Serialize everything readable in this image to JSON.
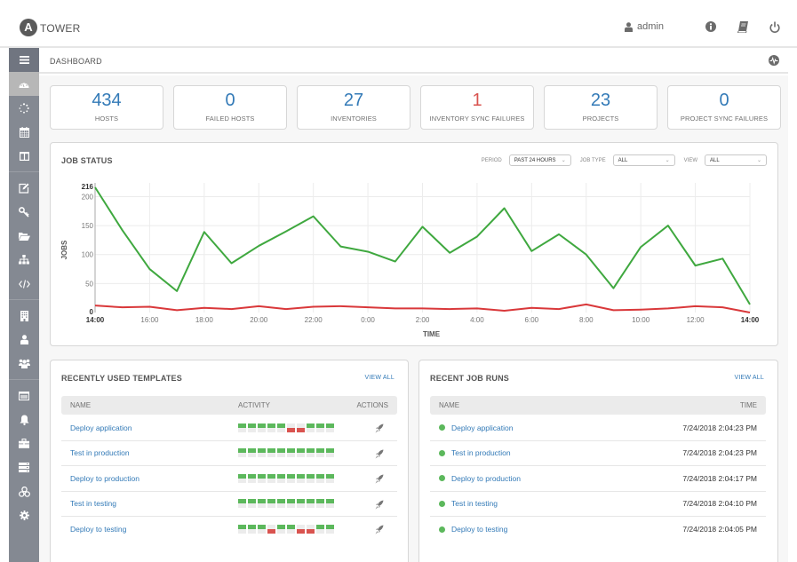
{
  "app": {
    "logo_letter": "A",
    "brand": "TOWER",
    "user": "admin",
    "icons": [
      "user-icon",
      "info-icon",
      "docs-book-icon",
      "power-logout-icon"
    ]
  },
  "breadcrumb": {
    "title": "DASHBOARD",
    "activity_icon": "activity-stream-icon"
  },
  "sidebar": {
    "items": [
      {
        "name": "menu",
        "icon": "hamburger-menu-icon"
      },
      {
        "name": "dashboard",
        "icon": "dashboard-gauge-icon",
        "active": true
      },
      {
        "name": "jobs",
        "icon": "jobs-spinner-icon"
      },
      {
        "name": "schedules",
        "icon": "calendar-icon"
      },
      {
        "name": "portal",
        "icon": "portal-columns-icon"
      },
      {
        "name": "templates",
        "icon": "edit-template-icon"
      },
      {
        "name": "credentials",
        "icon": "key-icon"
      },
      {
        "name": "projects",
        "icon": "folder-open-icon"
      },
      {
        "name": "inventories",
        "icon": "sitemap-icon"
      },
      {
        "name": "inventory-scripts",
        "icon": "code-icon"
      },
      {
        "name": "organizations",
        "icon": "building-icon"
      },
      {
        "name": "users",
        "icon": "user-icon"
      },
      {
        "name": "teams",
        "icon": "users-group-icon"
      },
      {
        "name": "credential-types",
        "icon": "window-card-icon"
      },
      {
        "name": "notifications",
        "icon": "bell-icon"
      },
      {
        "name": "management-jobs",
        "icon": "briefcase-icon"
      },
      {
        "name": "instance-groups",
        "icon": "server-stack-icon"
      },
      {
        "name": "applications",
        "icon": "cubes-icon"
      },
      {
        "name": "settings",
        "icon": "gear-icon"
      }
    ]
  },
  "counts": [
    {
      "value": "434",
      "label": "HOSTS",
      "status": "normal"
    },
    {
      "value": "0",
      "label": "FAILED HOSTS",
      "status": "normal"
    },
    {
      "value": "27",
      "label": "INVENTORIES",
      "status": "normal"
    },
    {
      "value": "1",
      "label": "INVENTORY SYNC FAILURES",
      "status": "fail"
    },
    {
      "value": "23",
      "label": "PROJECTS",
      "status": "normal"
    },
    {
      "value": "0",
      "label": "PROJECT SYNC FAILURES",
      "status": "normal"
    }
  ],
  "job_status": {
    "title": "JOB STATUS",
    "filters": {
      "period_label": "PERIOD",
      "period_value": "PAST 24 HOURS",
      "job_type_label": "JOB TYPE",
      "job_type_value": "ALL",
      "view_label": "VIEW",
      "view_value": "ALL"
    }
  },
  "chart_data": {
    "type": "line",
    "title": "JOB STATUS",
    "xlabel": "TIME",
    "ylabel": "JOBS",
    "x": [
      "14:00",
      "15:00",
      "16:00",
      "17:00",
      "18:00",
      "19:00",
      "20:00",
      "21:00",
      "22:00",
      "23:00",
      "0:00",
      "1:00",
      "2:00",
      "3:00",
      "4:00",
      "5:00",
      "6:00",
      "7:00",
      "8:00",
      "9:00",
      "10:00",
      "11:00",
      "12:00",
      "13:00",
      "14:00"
    ],
    "x_tick_labels": [
      "14:00",
      "16:00",
      "18:00",
      "20:00",
      "22:00",
      "0:00",
      "2:00",
      "4:00",
      "6:00",
      "8:00",
      "10:00",
      "12:00",
      "14:00"
    ],
    "y_tick_labels": [
      "0",
      "50",
      "100",
      "150",
      "200",
      "216"
    ],
    "ylim": [
      0,
      216
    ],
    "grid": true,
    "series": [
      {
        "name": "successful",
        "color": "#3fa83f",
        "values": [
          216,
          142,
          75,
          37,
          139,
          85,
          115,
          140,
          166,
          114,
          105,
          88,
          148,
          103,
          131,
          180,
          106,
          135,
          100,
          42,
          113,
          150,
          81,
          93,
          14
        ]
      },
      {
        "name": "failed",
        "color": "#d9383a",
        "values": [
          12,
          9,
          10,
          4,
          8,
          6,
          11,
          6,
          10,
          11,
          9,
          7,
          7,
          6,
          7,
          3,
          8,
          6,
          14,
          4,
          5,
          7,
          11,
          9,
          0
        ]
      }
    ]
  },
  "templates": {
    "title": "RECENTLY USED TEMPLATES",
    "view_all": "VIEW ALL",
    "columns": [
      "NAME",
      "ACTIVITY",
      "ACTIONS"
    ],
    "rows": [
      {
        "name": "Deploy application",
        "activity": [
          "ok",
          "ok",
          "ok",
          "ok",
          "ok",
          "fail",
          "fail",
          "ok",
          "ok",
          "ok"
        ],
        "action_icon": "rocket-launch-icon"
      },
      {
        "name": "Test in production",
        "activity": [
          "ok",
          "ok",
          "ok",
          "ok",
          "ok",
          "ok",
          "ok",
          "ok",
          "ok",
          "ok"
        ],
        "action_icon": "rocket-launch-icon"
      },
      {
        "name": "Deploy to production",
        "activity": [
          "ok",
          "ok",
          "ok",
          "ok",
          "ok",
          "ok",
          "ok",
          "ok",
          "ok",
          "ok"
        ],
        "action_icon": "rocket-launch-icon"
      },
      {
        "name": "Test in testing",
        "activity": [
          "ok",
          "ok",
          "ok",
          "ok",
          "ok",
          "ok",
          "ok",
          "ok",
          "ok",
          "ok"
        ],
        "action_icon": "rocket-launch-icon"
      },
      {
        "name": "Deploy to testing",
        "activity": [
          "ok",
          "ok",
          "ok",
          "fail",
          "ok",
          "ok",
          "fail",
          "fail",
          "ok",
          "ok"
        ],
        "action_icon": "rocket-launch-icon"
      }
    ]
  },
  "job_runs": {
    "title": "RECENT JOB RUNS",
    "view_all": "VIEW ALL",
    "columns": [
      "NAME",
      "TIME"
    ],
    "rows": [
      {
        "name": "Deploy application",
        "time": "7/24/2018 2:04:23 PM",
        "status": "successful"
      },
      {
        "name": "Test in production",
        "time": "7/24/2018 2:04:23 PM",
        "status": "successful"
      },
      {
        "name": "Deploy to production",
        "time": "7/24/2018 2:04:17 PM",
        "status": "successful"
      },
      {
        "name": "Test in testing",
        "time": "7/24/2018 2:04:10 PM",
        "status": "successful"
      },
      {
        "name": "Deploy to testing",
        "time": "7/24/2018 2:04:05 PM",
        "status": "successful"
      }
    ]
  },
  "colors": {
    "accent": "#337ab7",
    "fail": "#d9534f",
    "success": "#5cb85c",
    "sidebar": "#848992"
  }
}
